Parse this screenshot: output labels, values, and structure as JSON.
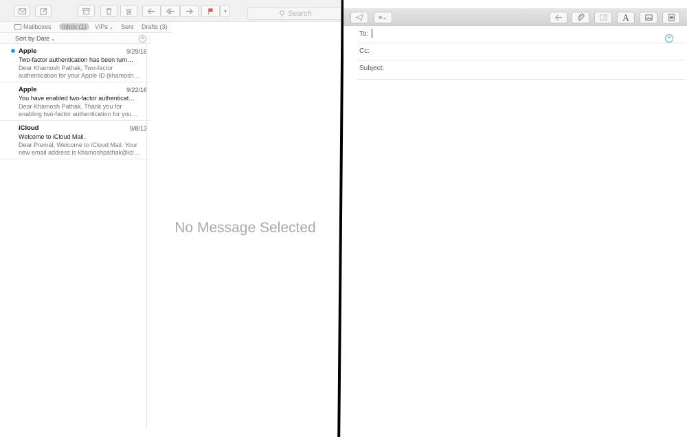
{
  "left_window": {
    "toolbar": {
      "search_placeholder": "Search"
    },
    "favorites_bar": {
      "mailboxes": "Mailboxes",
      "inbox": "Inbox (1)",
      "vips": "VIPs",
      "sent": "Sent",
      "drafts": "Drafts (3)"
    },
    "sort_label": "Sort by Date",
    "messages": [
      {
        "sender": "Apple",
        "date": "9/29/16",
        "subject": "Two-factor authentication has been turn…",
        "preview": "Dear Khamosh Pathak, Two-factor authentication for your Apple ID (khamosh…",
        "unread": true
      },
      {
        "sender": "Apple",
        "date": "9/22/16",
        "subject": "You have enabled two-factor authenticat…",
        "preview": "Dear Khamosh Pathak, Thank you for enabling two-factor authentication for you…",
        "unread": false
      },
      {
        "sender": "iCloud",
        "date": "9/8/13",
        "subject": "Welcome to iCloud Mail.",
        "preview": "Dear Premal, Welcome to iCloud Mail. Your new email address is khamoshpathak@icl…",
        "unread": false
      }
    ],
    "empty_state": "No Message Selected"
  },
  "compose": {
    "to_label": "To:",
    "cc_label": "Cc:",
    "subject_label": "Subject:",
    "to_value": "",
    "cc_value": "",
    "subject_value": ""
  },
  "colors": {
    "unread_dot": "#2f95e8",
    "flag": "#f04c3e",
    "add_contact": "#5aa6ef"
  }
}
